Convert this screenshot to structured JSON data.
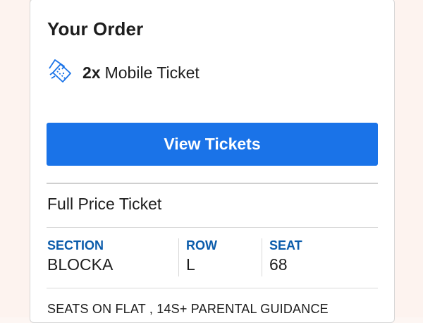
{
  "order": {
    "title": "Your Order",
    "ticket": {
      "quantity": "2x",
      "type": "Mobile Ticket",
      "icon": "ticket-icon"
    },
    "view_button": "View Tickets",
    "price_type": "Full Price Ticket",
    "seat_info": [
      {
        "label": "SECTION",
        "value": "BLOCKA"
      },
      {
        "label": "ROW",
        "value": "L"
      },
      {
        "label": "SEAT",
        "value": "68"
      }
    ],
    "notes": "SEATS ON FLAT , 14S+ PARENTAL GUIDANCE"
  },
  "colors": {
    "accent": "#1a73e8",
    "label_blue": "#0b5cab",
    "background": "#fdf6f3"
  }
}
